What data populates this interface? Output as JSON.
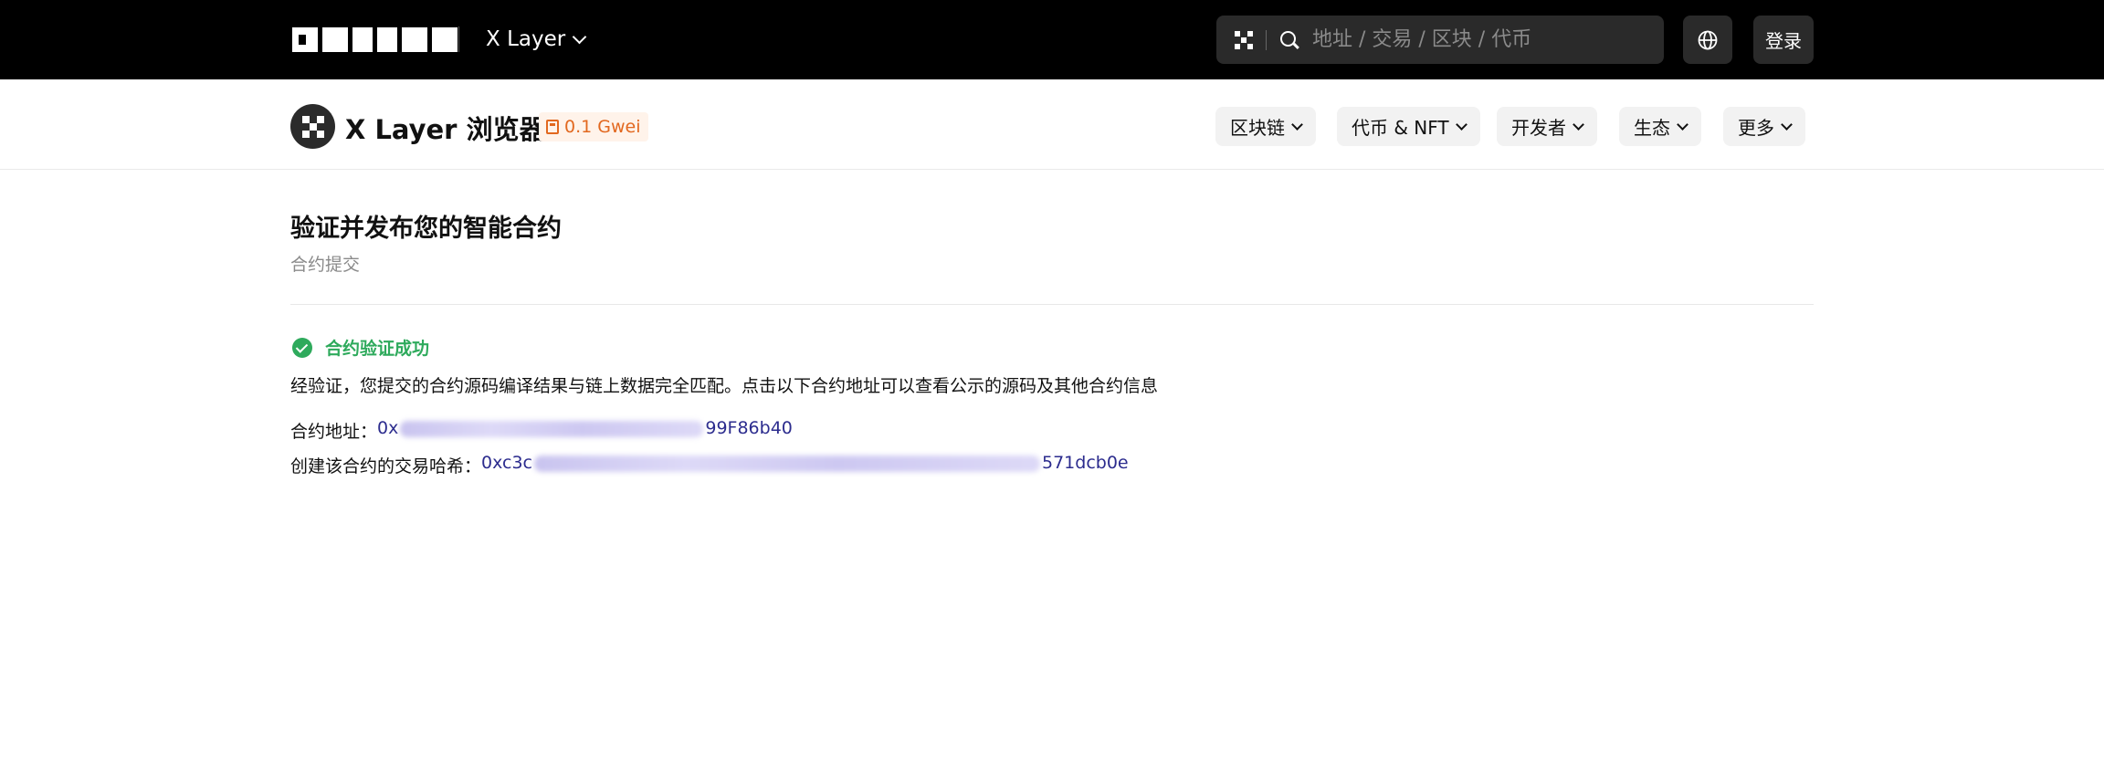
{
  "topbar": {
    "logo": "OKLINK",
    "network": "X Layer",
    "search_placeholder": "地址 / 交易 / 区块 / 代币",
    "login_label": "登录",
    "icons": [
      "qr-icon",
      "search-icon",
      "globe-icon",
      "chevron-down-icon"
    ]
  },
  "subheader": {
    "brand_title": "X Layer 浏览器",
    "gas_price": "0.1 Gwei",
    "nav": [
      {
        "label": "区块链"
      },
      {
        "label": "代币 & NFT"
      },
      {
        "label": "开发者"
      },
      {
        "label": "生态"
      },
      {
        "label": "更多"
      }
    ]
  },
  "main": {
    "title": "验证并发布您的智能合约",
    "subtitle": "合约提交",
    "status": "合约验证成功",
    "description": "经验证，您提交的合约源码编译结果与链上数据完全匹配。点击以下合约地址可以查看公示的源码及其他合约信息",
    "contract_label": "合约地址：",
    "contract_prefix": "0x",
    "contract_suffix": "99F86b40",
    "tx_label": "创建该合约的交易哈希：",
    "tx_prefix": "0xc3c",
    "tx_suffix": "571dcb0e"
  },
  "colors": {
    "topbar_bg": "#000000",
    "success": "#2eaa5c",
    "link": "#2c2c8e",
    "gas": "#e2681f"
  }
}
